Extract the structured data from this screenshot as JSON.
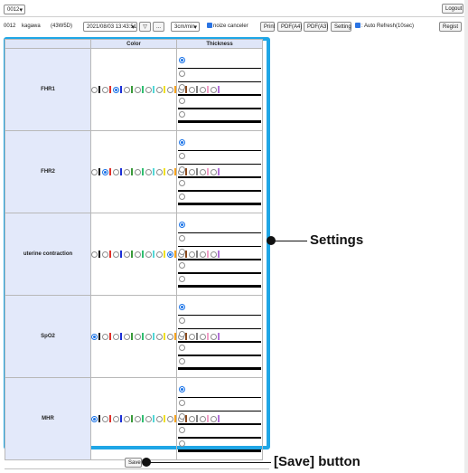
{
  "header": {
    "device_select": "0012",
    "logout_label": "Logout",
    "device_id": "0012",
    "patient_name": "kagawa",
    "gestation": "(43W5D)",
    "datetime_select": "2021/08/03 13:43:51",
    "calendar_glyph": "▽",
    "ellipsis_label": "...",
    "speed_select": "3cm/min",
    "noize_label": "noize canceler",
    "print_label": "Print",
    "pdf_a4_label": "PDF(A4)",
    "pdf_a3_label": "PDF(A3)",
    "setting_label": "Setting",
    "auto_refresh_label": ": Auto Refresh(10sec)",
    "regist_label": "Regist"
  },
  "table": {
    "color_header": "Color",
    "thickness_header": "Thickness"
  },
  "swatch_colors": [
    "#111111",
    "#e0302a",
    "#1b2fd6",
    "#3a9a3a",
    "#2fbf70",
    "#52d8d8",
    "#f0e020",
    "#f7a21a",
    "#8a4a1e",
    "#808080",
    "#f2a0c8",
    "#b070d8"
  ],
  "rows": [
    {
      "label": "FHR1",
      "selected_color": 2,
      "selected_thickness": 0
    },
    {
      "label": "FHR2",
      "selected_color": 1,
      "selected_thickness": 0
    },
    {
      "label": "uterine contraction",
      "selected_color": 7,
      "selected_thickness": 0
    },
    {
      "label": "SpO2",
      "selected_color": 0,
      "selected_thickness": 0
    },
    {
      "label": "MHR",
      "selected_color": 0,
      "selected_thickness": 0
    }
  ],
  "save_label": "Save",
  "annotations": {
    "settings": "Settings",
    "save_button": "[Save] button"
  }
}
